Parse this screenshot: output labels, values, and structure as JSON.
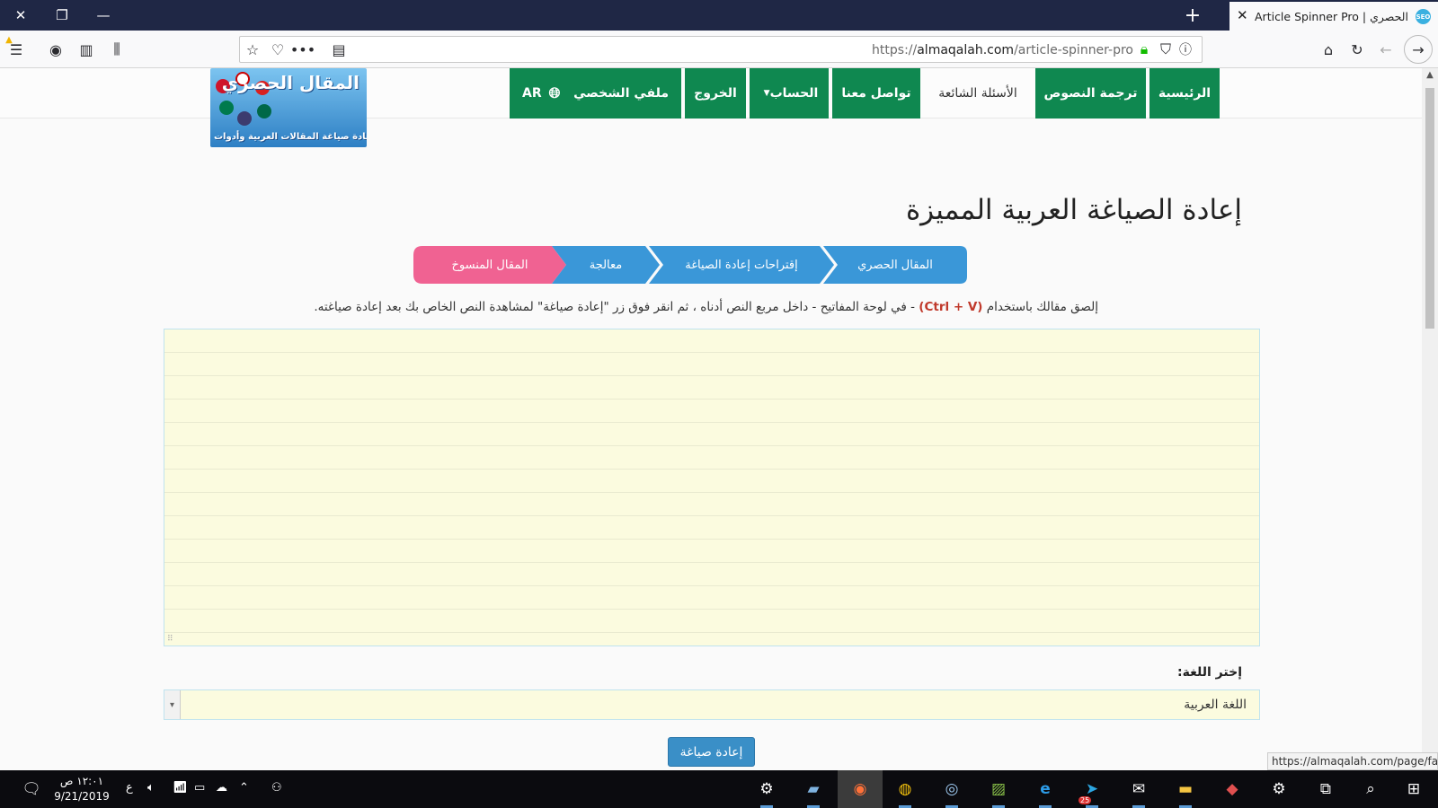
{
  "browser": {
    "tab_title": "Article Spinner Pro | المقال الحصري",
    "favicon_text": "SEO",
    "url_prefix": "https://",
    "url_domain": "almaqalah.com",
    "url_path": "/article-spinner-pro",
    "status_url": "https://almaqalah.com/page/faq"
  },
  "nav": {
    "home": "الرئيسية",
    "translate": "ترجمة النصوص",
    "faq": "الأسئلة الشائعة",
    "contact": "تواصل معنا",
    "account": "الحساب",
    "logout": "الخروج",
    "profile": "ملفي الشخصي",
    "lang": "AR"
  },
  "logo": {
    "title": "المقال الحصري",
    "subtitle": "إعادة صياغة المقالات العربية وأدوات SEO"
  },
  "page": {
    "heading": "إعادة الصياغة العربية المميزة",
    "steps": [
      "المقال الحصري",
      "إقتراحات إعادة الصياغة",
      "معالجة",
      "المقال المنسوخ"
    ],
    "instr_before": "إلصق مقالك باستخدام",
    "instr_keys": "(Ctrl + V)",
    "instr_after": "- في لوحة المفاتيح - داخل مربع النص أدناه ، ثم انقر فوق زر \"إعادة صياغة\" لمشاهدة النص الخاص بك بعد إعادة صياغته.",
    "lang_label": "إختر اللغة:",
    "lang_value": "اللغة العربية",
    "rephrase_button": "إعادة صياغة"
  },
  "taskbar": {
    "time": "١٢:٠١ ص",
    "date": "9/21/2019",
    "ime": "ع",
    "telegram_badge": "25"
  },
  "colors": {
    "nav_green": "#0f8850",
    "step_blue": "#3a97d8",
    "step_pink": "#f06292",
    "button_blue": "#3a8fc7"
  }
}
